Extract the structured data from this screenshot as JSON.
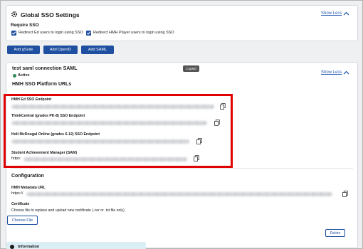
{
  "global_settings": {
    "title": "Global SSO Settings",
    "show_less": "Show Less",
    "require_sso": "Require SSO",
    "checkboxes": [
      {
        "label": "Redirect Ed users to login using SSO",
        "checked": true
      },
      {
        "label": "Redirect HMH Player users to login using SSO",
        "checked": true
      }
    ]
  },
  "actions": {
    "add_gsuite": "Add gSuite",
    "add_openid": "Add OpenID",
    "add_saml": "Add SAML"
  },
  "connection": {
    "title": "test saml connection  SAML",
    "status": "Active",
    "show_less": "Show Less",
    "platform_urls_title": "HMH SSO Platform URLs",
    "endpoints": [
      {
        "label": "HMH Ed SSO Endpoint"
      },
      {
        "label": "ThinkCentral (grades PK-8) SSO Endpoint"
      },
      {
        "label": "Holt McDougal Online (grades 6-12) SSO Endpoint"
      },
      {
        "label": "Student Achievement Manager (SAM)",
        "prefix": "https:"
      }
    ],
    "copied_tooltip": "Copied",
    "configuration_title": "Configuration",
    "metadata_label": "HMH Metadata URL",
    "metadata_prefix": "https://",
    "certificate_label": "Certificate",
    "certificate_help": "Choose file to replace and upload new certificate (.cer or .txt file only)",
    "choose_file": "Choose File",
    "delete": "Delete",
    "information": "Information"
  },
  "colors": {
    "primary": "#1f4fa0",
    "highlight": "#e00000",
    "active": "#2e8b57",
    "info_bg": "#d9eef5"
  }
}
